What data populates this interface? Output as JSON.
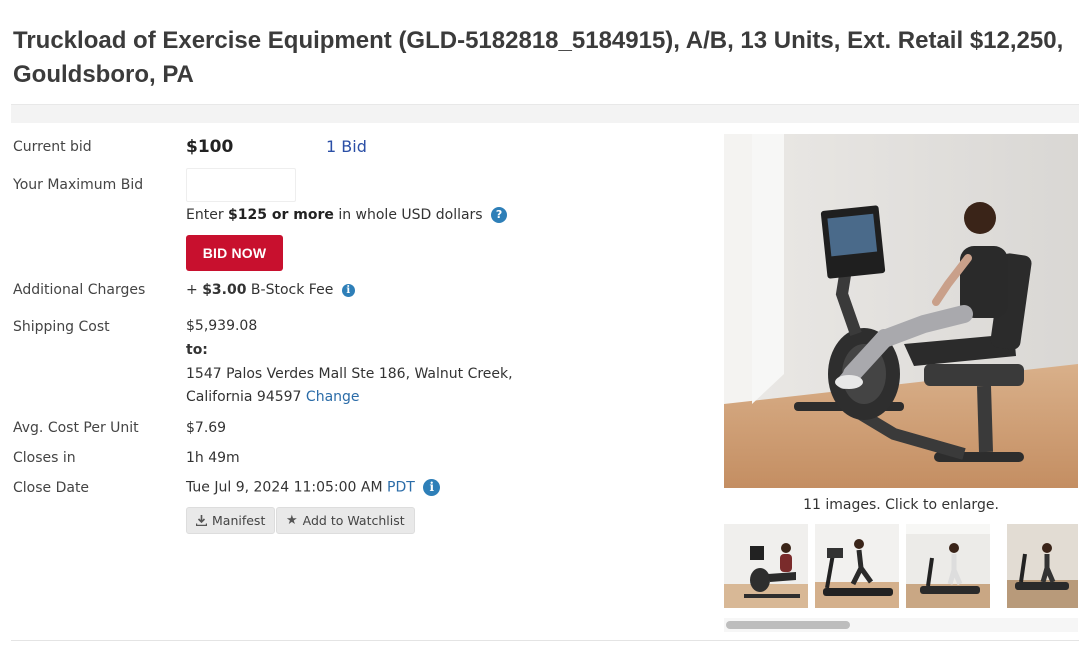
{
  "listing": {
    "title": "Truckload of Exercise Equipment (GLD-5182818_5184915), A/B, 13 Units, Ext. Retail $12,250, Gouldsboro, PA"
  },
  "bid": {
    "current_bid_label": "Current bid",
    "current_bid_value": "$100",
    "bid_count": "1 Bid",
    "max_bid_label": "Your Maximum Bid",
    "max_bid_value": "",
    "hint_prefix": "Enter ",
    "hint_amount": "$125 or more",
    "hint_suffix": " in whole USD dollars",
    "bid_button": "BID NOW"
  },
  "charges": {
    "label": "Additional Charges",
    "prefix": "+ ",
    "amount": "$3.00",
    "name": " B-Stock Fee"
  },
  "shipping": {
    "label": "Shipping Cost",
    "cost": "$5,939.08",
    "to_label": "to:",
    "address_line1": "1547 Palos Verdes Mall Ste 186, Walnut Creek,",
    "address_line2": "California 94597",
    "change_link": "Change"
  },
  "avg_cost": {
    "label": "Avg. Cost Per Unit",
    "value": "$7.69"
  },
  "closes_in": {
    "label": "Closes in",
    "value": "1h 49m"
  },
  "close_date": {
    "label": "Close Date",
    "value": "Tue Jul 9, 2024 11:05:00 AM",
    "tz": "PDT"
  },
  "actions": {
    "manifest": "Manifest",
    "watchlist": "Add to Watchlist"
  },
  "gallery": {
    "caption": "11 images. Click to enlarge.",
    "thumbnails": [
      "recumbent-bike",
      "treadmill",
      "treadmill-walking",
      "treadmill-room"
    ]
  },
  "colors": {
    "bid_button": "#c8102e",
    "link": "#2b6ca8",
    "info": "#2e7fb8"
  },
  "icons": {
    "help": "question-icon",
    "info": "info-icon",
    "download": "download-icon",
    "star": "star-icon"
  }
}
